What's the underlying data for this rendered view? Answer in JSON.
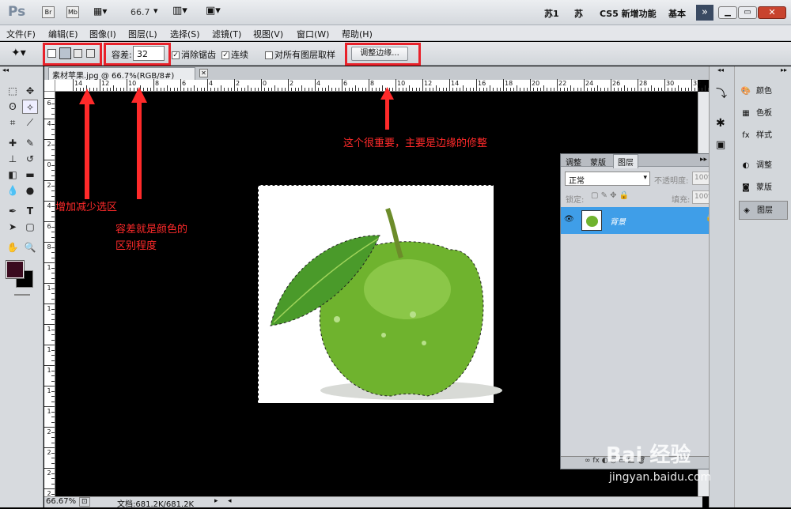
{
  "app": {
    "logo": "Ps",
    "br": "Br",
    "mb": "Mb",
    "zoom": "66.7",
    "workspaces": [
      "苏1",
      "苏",
      "CS5 新增功能",
      "基本"
    ]
  },
  "menu": [
    "文件(F)",
    "编辑(E)",
    "图像(I)",
    "图层(L)",
    "选择(S)",
    "滤镜(T)",
    "视图(V)",
    "窗口(W)",
    "帮助(H)"
  ],
  "options": {
    "tolerance_label": "容差:",
    "tolerance_value": "32",
    "antialias_label": "消除锯齿",
    "contiguous_label": "连续",
    "sample_all_label": "对所有图层取样",
    "refine_edge_label": "调整边缘..."
  },
  "document": {
    "tab_title": "素材苹果.jpg @ 66.7%(RGB/8#)",
    "ruler_top": [
      "14",
      "12",
      "10",
      "8",
      "6",
      "4",
      "2",
      "0",
      "2",
      "4",
      "6",
      "8",
      "10",
      "12",
      "14",
      "16",
      "18",
      "20",
      "22",
      "24",
      "26",
      "28",
      "30",
      "32"
    ],
    "ruler_left": [
      "6",
      "4",
      "2",
      "0",
      "2",
      "4",
      "6",
      "8",
      "1",
      "1",
      "1",
      "1",
      "1",
      "1",
      "1",
      "1",
      "2",
      "2",
      "2",
      "2"
    ]
  },
  "annotations": {
    "add_reduce": "增加减少选区",
    "tolerance_note": [
      "容差就是颜色的",
      "区别程度"
    ],
    "refine_note": "这个很重要，主要是边缘的修整"
  },
  "status": {
    "zoom": "66.67%",
    "doc_size": "文档:681.2K/681.2K"
  },
  "layers_panel": {
    "tabs": [
      "调整",
      "蒙版",
      "图层"
    ],
    "blend_mode": "正常",
    "opacity_label": "不透明度:",
    "opacity_value": "100%",
    "lock_label": "锁定:",
    "fill_label": "填充:",
    "fill_value": "100%",
    "layer_name": "背景"
  },
  "dock": {
    "items": [
      "颜色",
      "色板",
      "样式",
      "调整",
      "蒙版",
      "图层"
    ]
  },
  "watermark": {
    "text": "Bai 经验",
    "url": "jingyan.baidu.com"
  },
  "colors": {
    "accent_red": "#e8212a",
    "selection_blue": "#3f9ee8",
    "foreground": "#3a0a1e"
  }
}
